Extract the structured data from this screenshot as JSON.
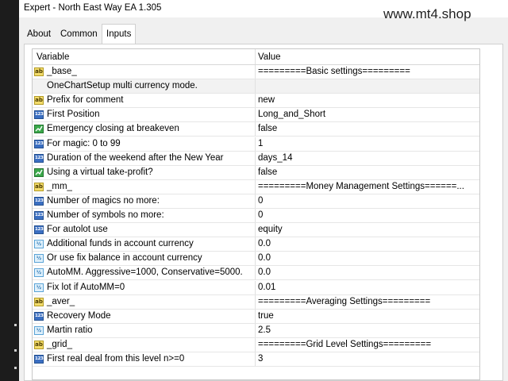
{
  "window": {
    "title": "Expert - North East Way EA 1.305"
  },
  "watermark": "www.mt4.shop",
  "tabs": [
    {
      "label": "About",
      "active": false
    },
    {
      "label": "Common",
      "active": false
    },
    {
      "label": "Inputs",
      "active": true
    }
  ],
  "columns": {
    "variable": "Variable",
    "value": "Value"
  },
  "icon_legend": {
    "ab": "string-type-icon",
    "i123": "integer-type-icon",
    "bool": "boolean-type-icon",
    "half": "double-type-icon"
  },
  "inputs": [
    {
      "icon": "ab",
      "variable": "_base_",
      "value": "=========Basic settings=========",
      "shaded": false
    },
    {
      "icon": "none",
      "variable": "OneChartSetup multi currency mode.",
      "value": "",
      "shaded": true
    },
    {
      "icon": "ab",
      "variable": "Prefix for comment",
      "value": "new",
      "shaded": false
    },
    {
      "icon": "i123",
      "variable": "First Position",
      "value": "Long_and_Short",
      "shaded": false
    },
    {
      "icon": "bool",
      "variable": "Emergency closing at breakeven",
      "value": "false",
      "shaded": false
    },
    {
      "icon": "i123",
      "variable": "For magic: 0 to 99",
      "value": "1",
      "shaded": false
    },
    {
      "icon": "i123",
      "variable": "Duration of the weekend after the New Year",
      "value": "days_14",
      "shaded": false
    },
    {
      "icon": "bool",
      "variable": "Using a virtual take-profit?",
      "value": "false",
      "shaded": false
    },
    {
      "icon": "ab",
      "variable": "_mm_",
      "value": "=========Money Management Settings======...",
      "shaded": false
    },
    {
      "icon": "i123",
      "variable": "Number of magics no more:",
      "value": "0",
      "shaded": false
    },
    {
      "icon": "i123",
      "variable": "Number of symbols no more:",
      "value": "0",
      "shaded": false
    },
    {
      "icon": "i123",
      "variable": "For autolot use",
      "value": "equity",
      "shaded": false
    },
    {
      "icon": "half",
      "variable": "Additional funds in account currency",
      "value": "0.0",
      "shaded": false
    },
    {
      "icon": "half",
      "variable": "Or use fix balance in account currency",
      "value": "0.0",
      "shaded": false
    },
    {
      "icon": "half",
      "variable": "AutoMM. Aggressive=1000, Conservative=5000.",
      "value": "0.0",
      "shaded": false
    },
    {
      "icon": "half",
      "variable": "Fix lot if AutoMM=0",
      "value": "0.01",
      "shaded": false
    },
    {
      "icon": "ab",
      "variable": "_aver_",
      "value": "=========Averaging Settings=========",
      "shaded": false
    },
    {
      "icon": "i123",
      "variable": "Recovery Mode",
      "value": "true",
      "shaded": false
    },
    {
      "icon": "half",
      "variable": "Martin ratio",
      "value": "2.5",
      "shaded": false
    },
    {
      "icon": "ab",
      "variable": "_grid_",
      "value": "=========Grid Level Settings=========",
      "shaded": false
    },
    {
      "icon": "i123",
      "variable": "First real deal from this level n>=0",
      "value": "3",
      "shaded": false
    }
  ]
}
